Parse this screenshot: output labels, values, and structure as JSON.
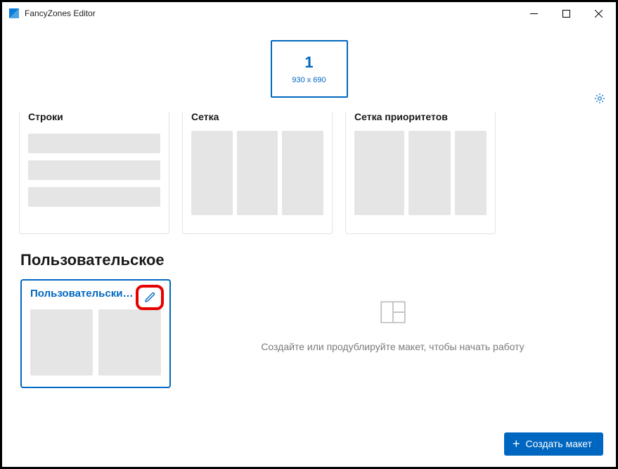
{
  "window": {
    "title": "FancyZones Editor"
  },
  "monitor": {
    "number": "1",
    "resolution": "930 x 690"
  },
  "templates": [
    {
      "title": "Строки",
      "type": "rows"
    },
    {
      "title": "Сетка",
      "type": "cols3"
    },
    {
      "title": "Сетка приоритетов",
      "type": "prio"
    }
  ],
  "custom_section_title": "Пользовательское",
  "custom_layouts": [
    {
      "title": "Пользовательский…"
    }
  ],
  "empty_state_text": "Создайте или продублируйте макет, чтобы начать работу",
  "create_button_label": "Создать макет",
  "icons": {
    "settings": "gear-icon",
    "edit": "pencil-icon",
    "layout": "layout-icon",
    "plus": "plus-icon"
  }
}
